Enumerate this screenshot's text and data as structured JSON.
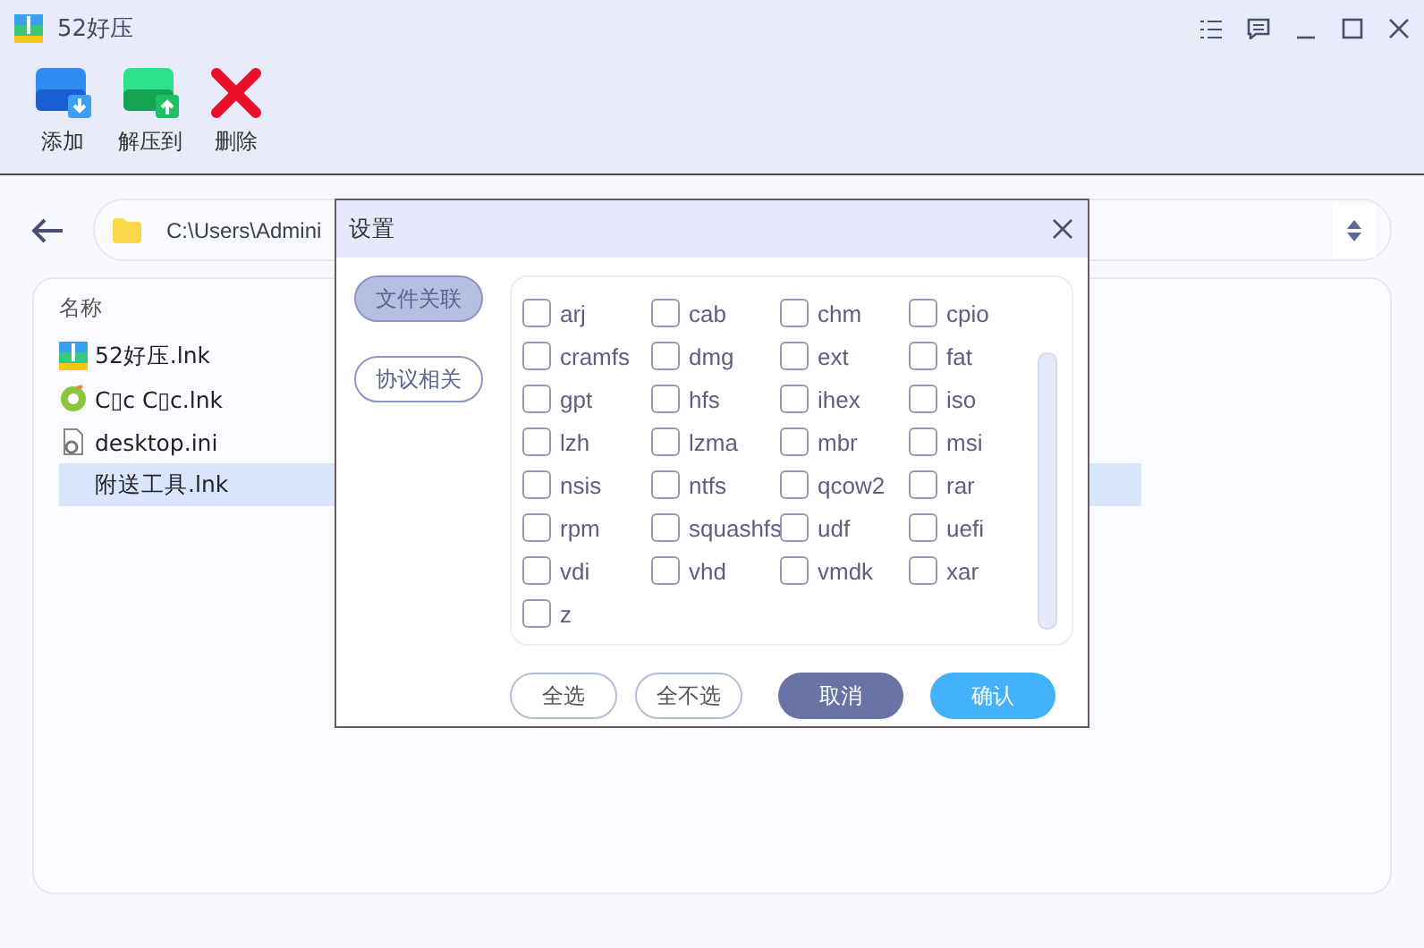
{
  "window": {
    "title": "52好压"
  },
  "toolbar": [
    {
      "kind": "add",
      "label": "添加"
    },
    {
      "kind": "extract",
      "label": "解压到"
    },
    {
      "kind": "delete",
      "label": "删除"
    }
  ],
  "path": "C:\\Users\\Admini",
  "file_list": {
    "header": "名称",
    "rows": [
      {
        "kind": "zip",
        "name": "52好压.lnk",
        "selected": false
      },
      {
        "kind": "browser",
        "name": "C▯c C▯c.lnk",
        "selected": false
      },
      {
        "kind": "settings",
        "name": "desktop.ini",
        "selected": false
      },
      {
        "kind": "none",
        "name": "附送工具.lnk",
        "selected": true
      }
    ]
  },
  "dialog": {
    "title": "设置",
    "tabs": [
      {
        "label": "文件关联",
        "selected": true
      },
      {
        "label": "协议相关",
        "selected": false
      }
    ],
    "formats": [
      {
        "label": "arj",
        "checked": false
      },
      {
        "label": "cab",
        "checked": false
      },
      {
        "label": "chm",
        "checked": false
      },
      {
        "label": "cpio",
        "checked": false
      },
      {
        "label": "cramfs",
        "checked": false
      },
      {
        "label": "dmg",
        "checked": false
      },
      {
        "label": "ext",
        "checked": false
      },
      {
        "label": "fat",
        "checked": false
      },
      {
        "label": "gpt",
        "checked": false
      },
      {
        "label": "hfs",
        "checked": false
      },
      {
        "label": "ihex",
        "checked": false
      },
      {
        "label": "iso",
        "checked": false
      },
      {
        "label": "lzh",
        "checked": false
      },
      {
        "label": "lzma",
        "checked": false
      },
      {
        "label": "mbr",
        "checked": false
      },
      {
        "label": "msi",
        "checked": false
      },
      {
        "label": "nsis",
        "checked": false
      },
      {
        "label": "ntfs",
        "checked": false
      },
      {
        "label": "qcow2",
        "checked": false
      },
      {
        "label": "rar",
        "checked": false
      },
      {
        "label": "rpm",
        "checked": false
      },
      {
        "label": "squashfs",
        "checked": false
      },
      {
        "label": "udf",
        "checked": false
      },
      {
        "label": "uefi",
        "checked": false
      },
      {
        "label": "vdi",
        "checked": false
      },
      {
        "label": "vhd",
        "checked": false
      },
      {
        "label": "vmdk",
        "checked": false
      },
      {
        "label": "xar",
        "checked": false
      },
      {
        "label": "z",
        "checked": false
      }
    ],
    "buttons": [
      {
        "kind": "outline",
        "label": "全选"
      },
      {
        "kind": "outline",
        "label": "全不选"
      },
      {
        "kind": "cancel",
        "label": "取消"
      },
      {
        "kind": "confirm",
        "label": "确认"
      }
    ]
  }
}
